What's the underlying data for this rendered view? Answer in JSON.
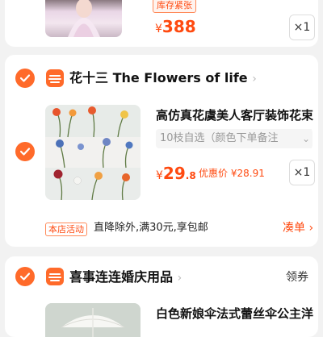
{
  "top_item": {
    "badge": "库存紧张",
    "currency": "¥",
    "price": "388",
    "qty": "×1"
  },
  "shop1": {
    "name": "花十三 The Flowers of life",
    "item": {
      "title": "高仿真花虞美人客厅装饰花束",
      "spec": "10枝自选（颜色下单备注",
      "currency": "¥",
      "price_int": "29",
      "price_dec": ".8",
      "discount_label": "优惠价",
      "discount_price": "¥28.91",
      "qty": "×1"
    },
    "promo": {
      "tag": "本店活动",
      "text": "直降除外,满30元,享包邮",
      "link": "凑单"
    }
  },
  "shop2": {
    "name": "喜事连连婚庆用品",
    "coupon": "领券",
    "item_title": "白色新娘伞法式蕾丝伞公主洋"
  },
  "colors": {
    "accent": "#ff6a2a",
    "price": "#ff4a10",
    "background": "#f2f2f2"
  }
}
